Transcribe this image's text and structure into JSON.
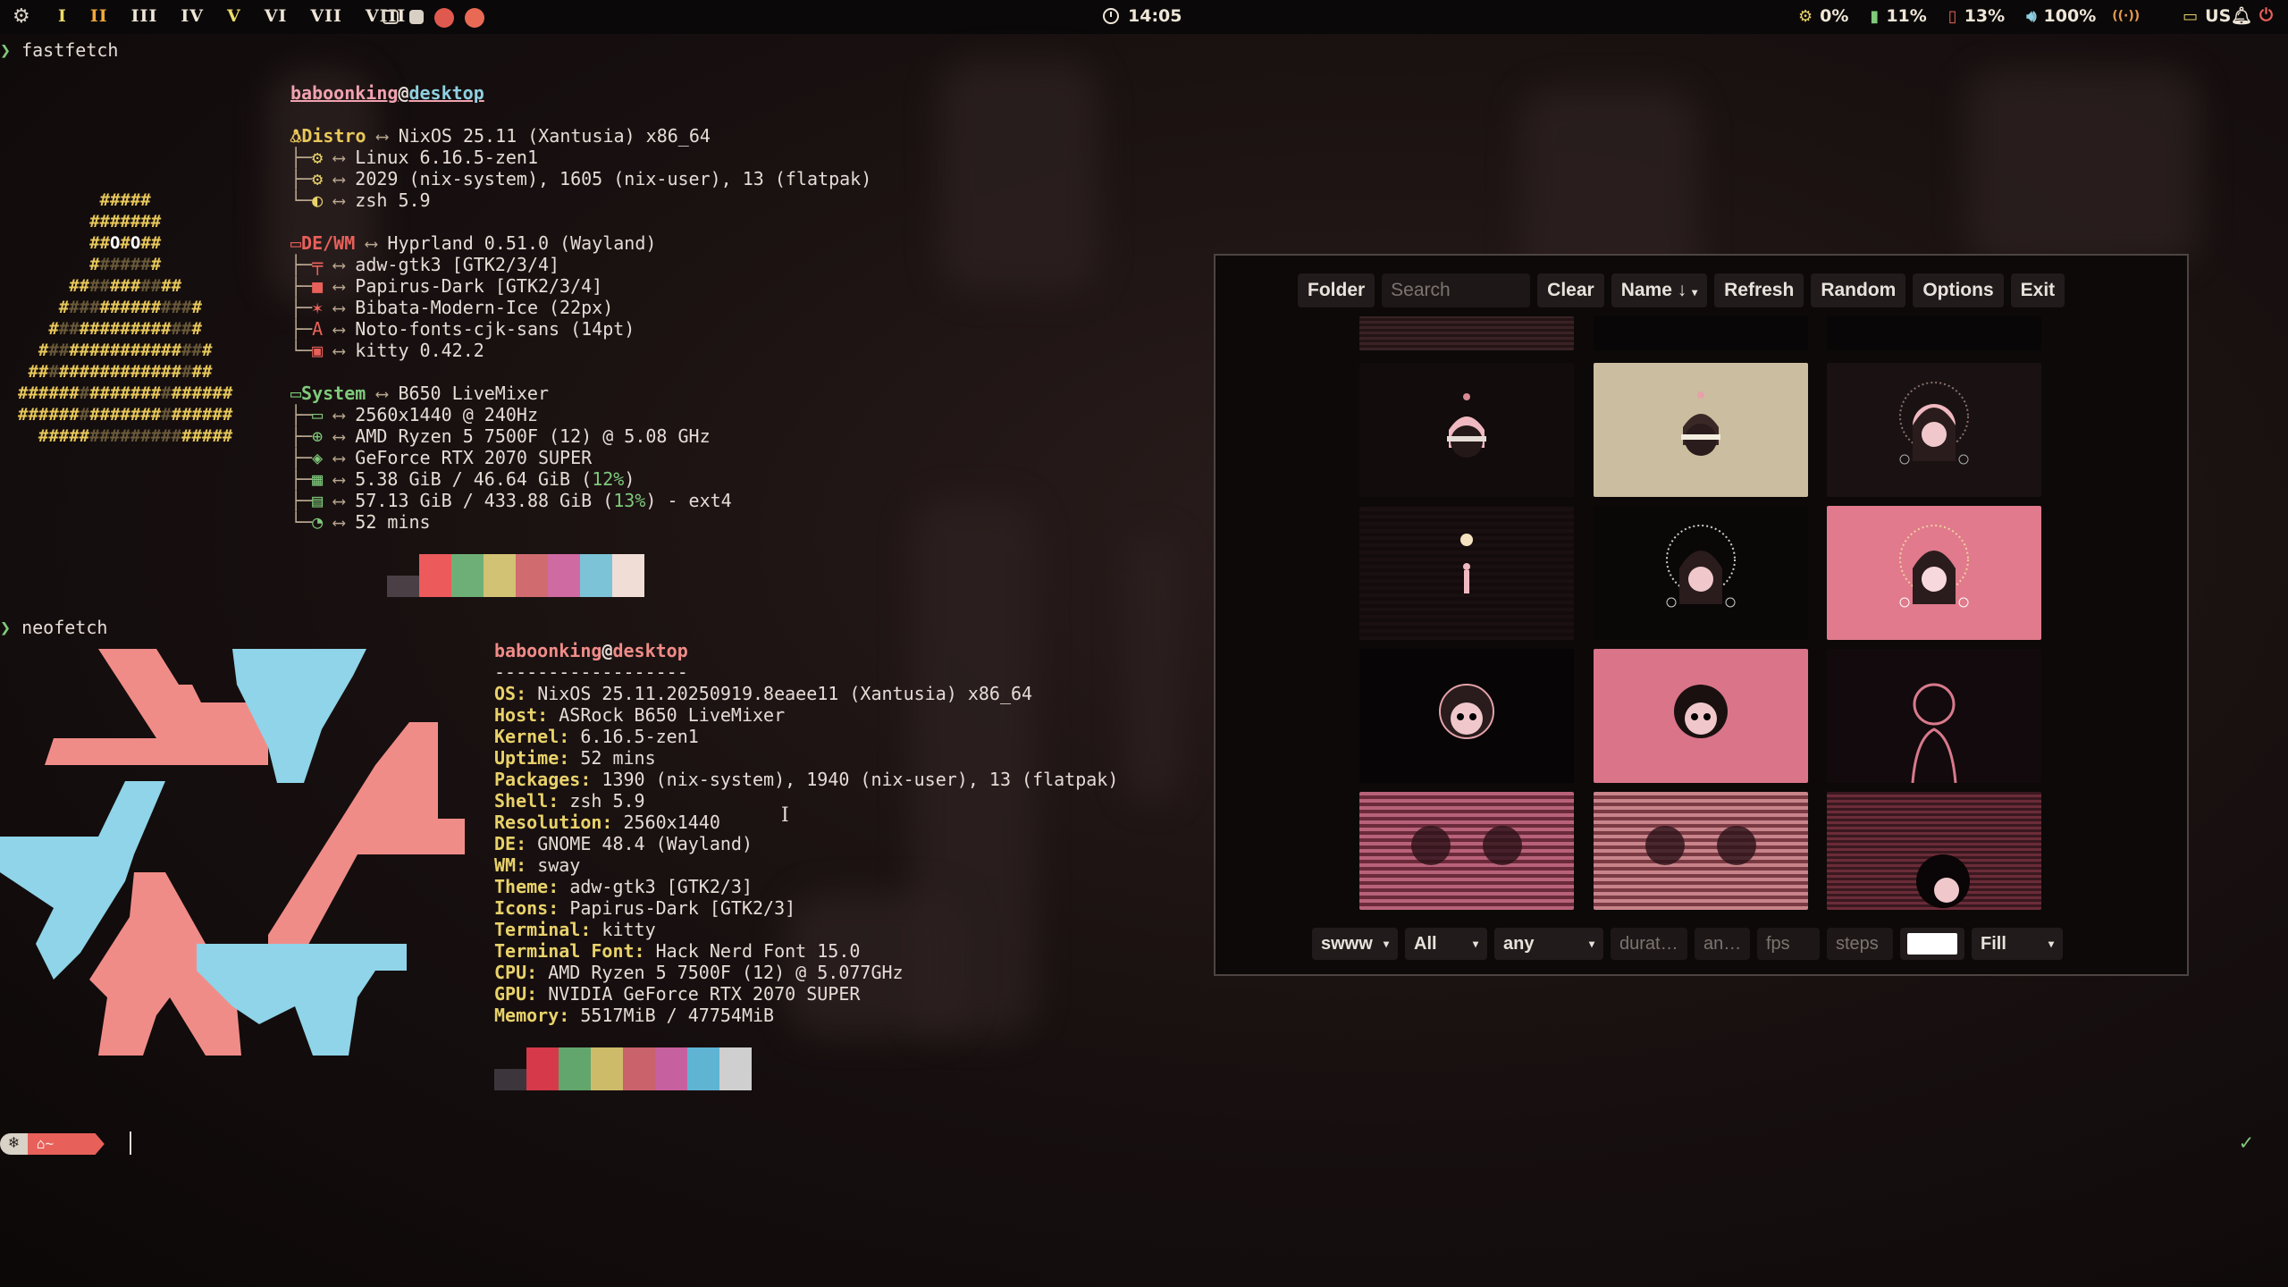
{
  "topbar": {
    "workspaces": [
      "I",
      "II",
      "III",
      "IV",
      "V",
      "VI",
      "VII",
      "VIII"
    ],
    "active_workspace": "II",
    "time": "14:05",
    "status": {
      "cpu": "0%",
      "memory": "11%",
      "battery": "13%",
      "volume": "100%",
      "keyboard_layout": "US"
    }
  },
  "fastfetch": {
    "command": "fastfetch",
    "user": "baboonking",
    "host": "desktop",
    "distro_label": "Distro",
    "distro": "NixOS 25.11 (Xantusia) x86_64",
    "kernel": "Linux 6.16.5-zen1",
    "packages": "2029 (nix-system), 1605 (nix-user), 13 (flatpak)",
    "shell": "zsh 5.9",
    "dewm_label": "DE/WM",
    "dewm": "Hyprland 0.51.0 (Wayland)",
    "theme": "adw-gtk3 [GTK2/3/4]",
    "icons": "Papirus-Dark [GTK2/3/4]",
    "cursor": "Bibata-Modern-Ice (22px)",
    "font": "Noto-fonts-cjk-sans (14pt)",
    "terminal": "kitty 0.42.2",
    "system_label": "System",
    "system": "B650 LiveMixer",
    "display": "2560x1440 @ 240Hz",
    "cpu": "AMD Ryzen 5 7500F (12) @ 5.08 GHz",
    "gpu": "GeForce RTX 2070 SUPER",
    "memory_main": "5.38 GiB / 46.64 GiB (",
    "memory_pct": "12%",
    "disk_main": "57.13 GiB / 433.88 GiB (",
    "disk_pct": "13%",
    "disk_fs": ") - ext4",
    "uptime": "52 mins",
    "arrow": "⟷",
    "colors": [
      "#4a3f44",
      "#ec5a5c",
      "#6eaf77",
      "#d2c274",
      "#d06c70",
      "#d06aa2",
      "#7cc3d8",
      "#f0ddd6"
    ]
  },
  "neofetch": {
    "command": "neofetch",
    "user": "baboonking",
    "host": "desktop",
    "separator": "------------------",
    "lines": [
      {
        "label": "OS",
        "value": "NixOS 25.11.20250919.8eaee11 (Xantusia) x86_64"
      },
      {
        "label": "Host",
        "value": "ASRock B650 LiveMixer"
      },
      {
        "label": "Kernel",
        "value": "6.16.5-zen1"
      },
      {
        "label": "Uptime",
        "value": "52 mins"
      },
      {
        "label": "Packages",
        "value": "1390 (nix-system), 1940 (nix-user), 13 (flatpak)"
      },
      {
        "label": "Shell",
        "value": "zsh 5.9"
      },
      {
        "label": "Resolution",
        "value": "2560x1440"
      },
      {
        "label": "DE",
        "value": "GNOME 48.4 (Wayland)"
      },
      {
        "label": "WM",
        "value": "sway"
      },
      {
        "label": "Theme",
        "value": "adw-gtk3 [GTK2/3]"
      },
      {
        "label": "Icons",
        "value": "Papirus-Dark [GTK2/3]"
      },
      {
        "label": "Terminal",
        "value": "kitty"
      },
      {
        "label": "Terminal Font",
        "value": "Hack Nerd Font 15.0"
      },
      {
        "label": "CPU",
        "value": "AMD Ryzen 5 7500F (12) @ 5.077GHz"
      },
      {
        "label": "GPU",
        "value": "NVIDIA GeForce RTX 2070 SUPER"
      },
      {
        "label": "Memory",
        "value": "5517MiB / 47754MiB"
      }
    ],
    "colors": [
      "#3c353b",
      "#d6394a",
      "#62a66d",
      "#cdbb6a",
      "#c9626a",
      "#c7609e",
      "#5fb4d4",
      "#cfcfcf"
    ]
  },
  "prompt": {
    "home_label": "~"
  },
  "picker": {
    "toolbar": {
      "folder": "Folder",
      "search_placeholder": "Search",
      "clear": "Clear",
      "sort": "Name ↓",
      "refresh": "Refresh",
      "random": "Random",
      "options": "Options",
      "exit": "Exit"
    },
    "bottombar": {
      "backend": "swww",
      "filter": "All",
      "transition": "any",
      "duration_placeholder": "durat…",
      "angle_placeholder": "an…",
      "fps_placeholder": "fps",
      "steps_placeholder": "steps",
      "fill": "Fill"
    },
    "thumbnails": [
      "striped-top-thumbnail",
      "dark-top-thumbnail",
      "dark-top-thumbnail",
      "dark-girl-cap-thumbnail",
      "beige-girl-cap-thumbnail",
      "halo-girl-dark-thumbnail",
      "moon-figure-thumbnail",
      "halo-girl-black-thumbnail",
      "halo-girl-pink-thumbnail",
      "skull-girl-black-thumbnail",
      "skull-girl-pink-thumbnail",
      "outline-girl-thumbnail",
      "striped-duo-thumbnail",
      "striped-duo-2-thumbnail",
      "girl-peeking-thumbnail"
    ]
  }
}
